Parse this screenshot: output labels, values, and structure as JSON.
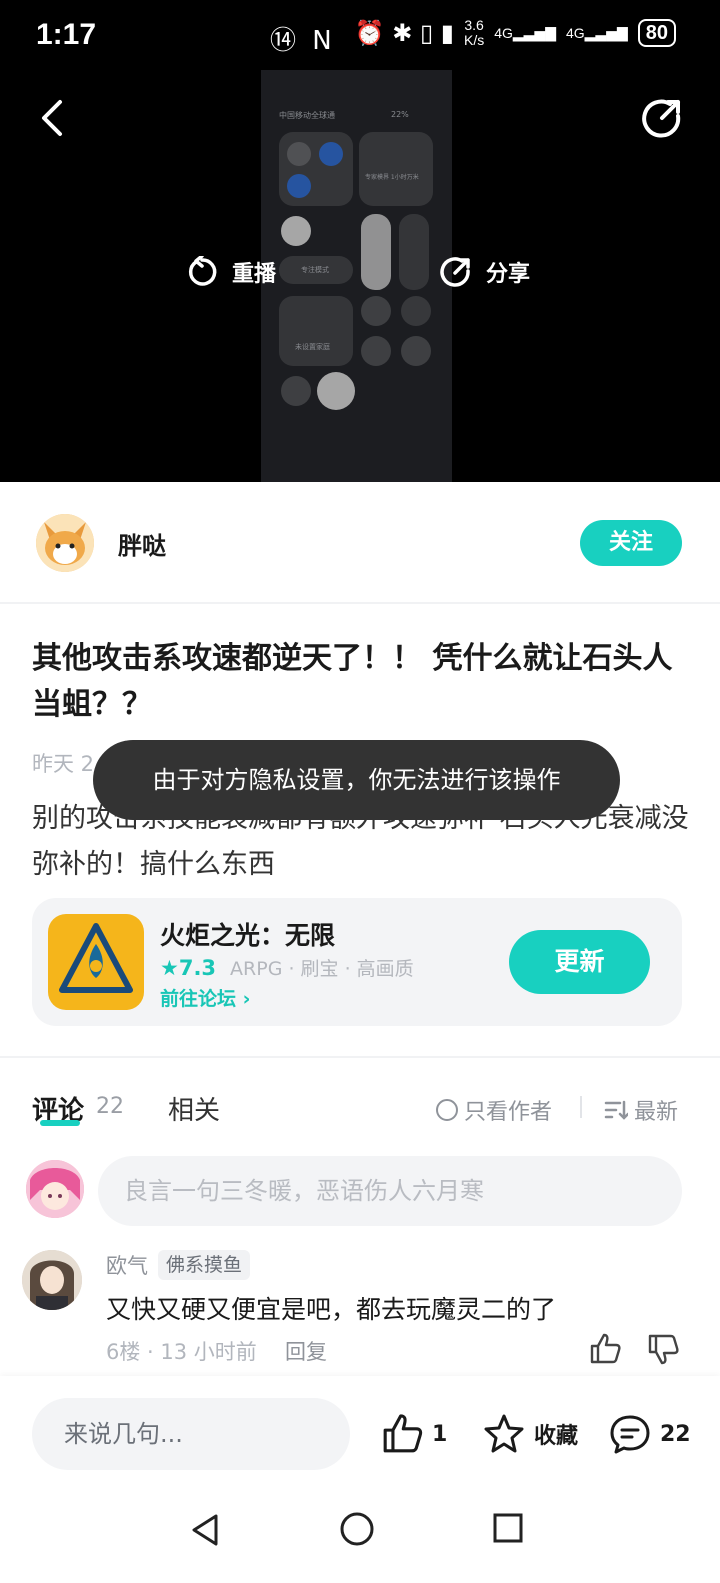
{
  "status_bar": {
    "time": "1:17",
    "left_icons": "⑭ N",
    "right_icons": "⏰ ✱ ▯ ▮",
    "net_speed_top": "3.6",
    "net_speed_bottom": "K/s",
    "signal_1": "4G",
    "signal_2": "4G",
    "battery": "80"
  },
  "video": {
    "replay_label": "重播",
    "share_label": "分享",
    "thumb_carrier": "中国移动全球通",
    "thumb_battery": "22%",
    "thumb_media": "专家模界 1小时万米",
    "thumb_focus": "专注模式",
    "thumb_home": "未设置家庭"
  },
  "author": {
    "name": "胖哒",
    "follow_label": "关注"
  },
  "post": {
    "title": "其他攻击系攻速都逆天了！！ 凭什么就让石头人当蛆？？",
    "meta": "昨天 2",
    "body": "别的攻击系技能衰减都有额外攻速弥补 石头人光衰减没弥补的！搞什么东西"
  },
  "toast": {
    "text": "由于对方隐私设置，你无法进行该操作"
  },
  "game_card": {
    "name": "火炬之光：无限",
    "rating": "7.3",
    "tags": "ARPG · 刷宝 · 高画质",
    "forum_link": "前往论坛",
    "update_label": "更新",
    "icon_color": "#f5b51b"
  },
  "tabs": {
    "comments_label": "评论",
    "comments_count": "22",
    "related_label": "相关",
    "author_only_label": "只看作者",
    "sort_label": "最新"
  },
  "comment_input": {
    "placeholder": "良言一句三冬暖，恶语伤人六月寒"
  },
  "comments": [
    {
      "user": "欧气",
      "badge": "佛系摸鱼",
      "text": "又快又硬又便宜是吧，都去玩魔灵二的了",
      "meta": "6楼 · 13 小时前",
      "reply_label": "回复"
    }
  ],
  "bottom_bar": {
    "say_placeholder": "来说几句...",
    "like_count": "1",
    "favorite_label": "收藏",
    "comment_count": "22"
  },
  "colors": {
    "accent": "#18d0c0",
    "toast_bg": "#333333"
  }
}
